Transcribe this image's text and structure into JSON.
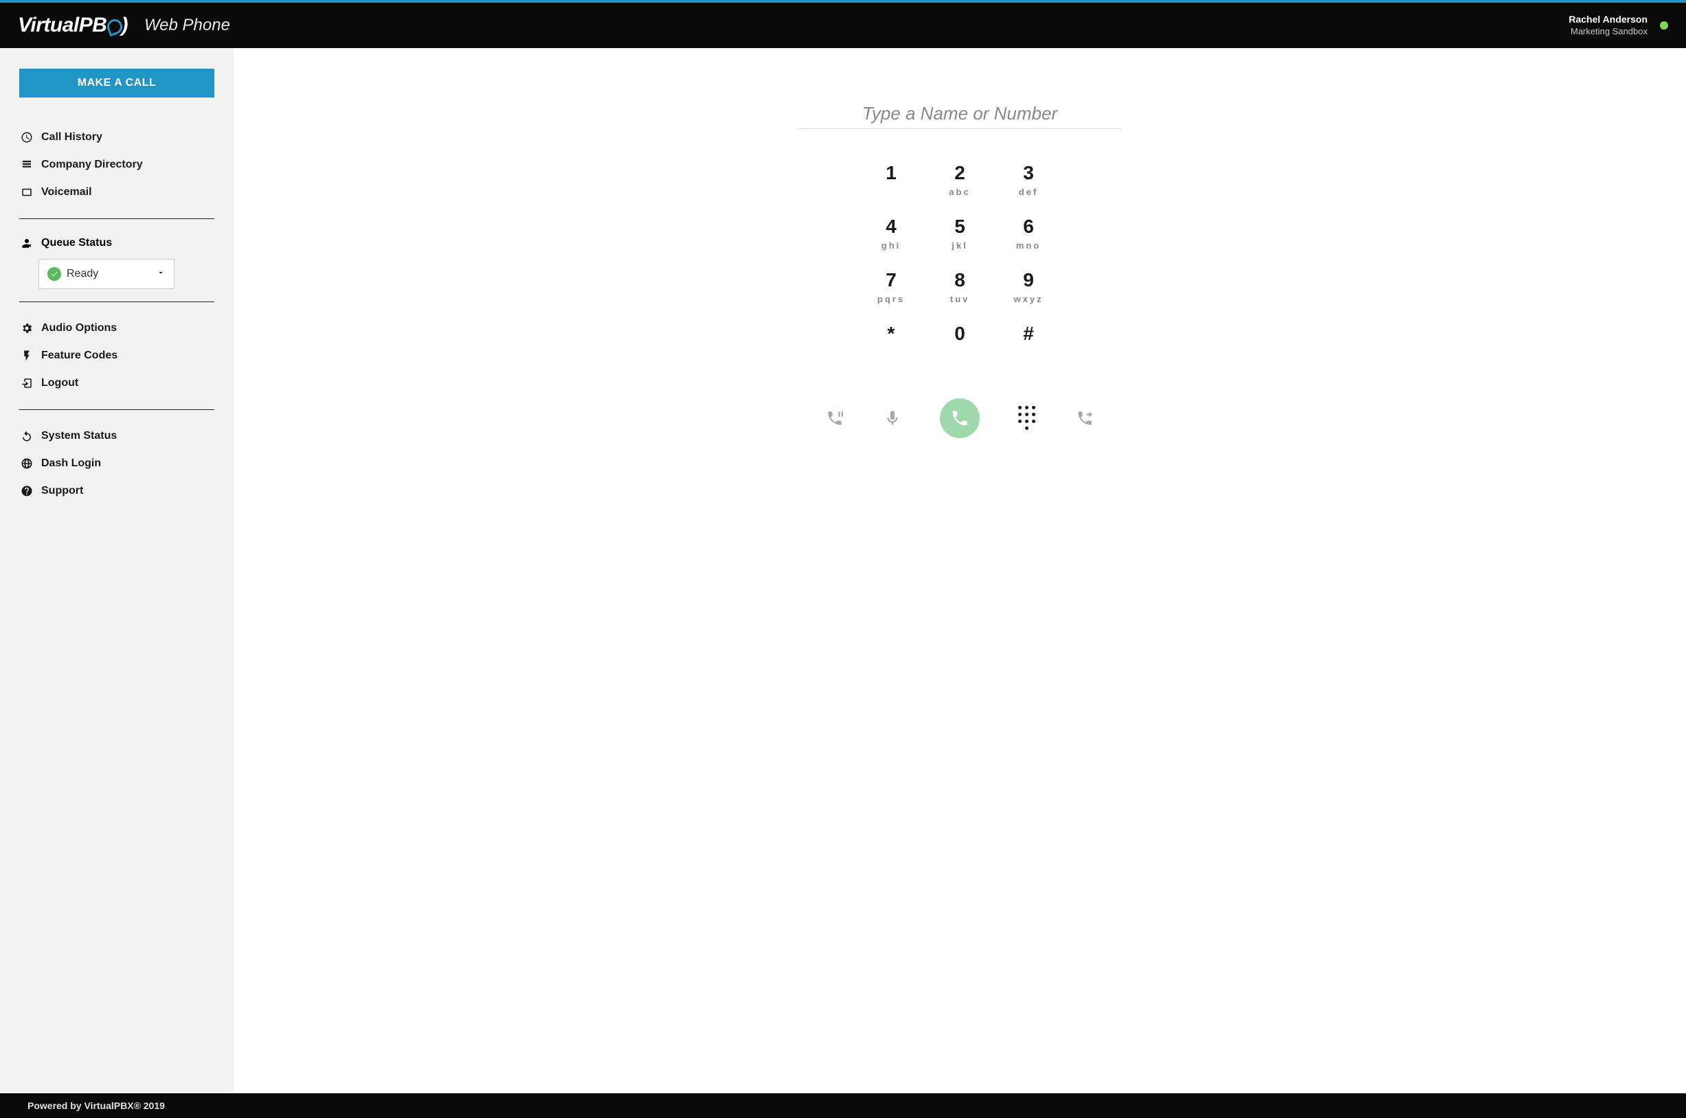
{
  "header": {
    "logo_prefix": "Virtual",
    "logo_suffix": "PB",
    "app_title": "Web Phone",
    "user_name": "Rachel Anderson",
    "user_team": "Marketing Sandbox"
  },
  "sidebar": {
    "make_call_label": "MAKE A CALL",
    "nav1": [
      {
        "label": "Call History",
        "icon": "clock-icon"
      },
      {
        "label": "Company Directory",
        "icon": "directory-icon"
      },
      {
        "label": "Voicemail",
        "icon": "voicemail-icon"
      }
    ],
    "queue_status_label": "Queue Status",
    "queue_selected": "Ready",
    "nav2": [
      {
        "label": "Audio Options",
        "icon": "gear-icon"
      },
      {
        "label": "Feature Codes",
        "icon": "bolt-icon"
      },
      {
        "label": "Logout",
        "icon": "logout-icon"
      }
    ],
    "nav3": [
      {
        "label": "System Status",
        "icon": "refresh-icon"
      },
      {
        "label": "Dash Login",
        "icon": "globe-icon"
      },
      {
        "label": "Support",
        "icon": "help-icon"
      }
    ]
  },
  "dialer": {
    "input_placeholder": "Type a Name or Number",
    "keys": [
      {
        "d": "1",
        "l": ""
      },
      {
        "d": "2",
        "l": "abc"
      },
      {
        "d": "3",
        "l": "def"
      },
      {
        "d": "4",
        "l": "ghi"
      },
      {
        "d": "5",
        "l": "jkl"
      },
      {
        "d": "6",
        "l": "mno"
      },
      {
        "d": "7",
        "l": "pqrs"
      },
      {
        "d": "8",
        "l": "tuv"
      },
      {
        "d": "9",
        "l": "wxyz"
      },
      {
        "d": "*",
        "l": ""
      },
      {
        "d": "0",
        "l": ""
      },
      {
        "d": "#",
        "l": ""
      }
    ]
  },
  "footer": {
    "text": "Powered by VirtualPBX® 2019"
  }
}
